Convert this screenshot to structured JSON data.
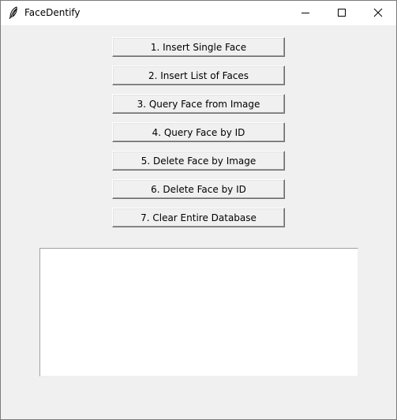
{
  "window": {
    "title": "FaceDentify"
  },
  "buttons": [
    {
      "label": "1. Insert Single Face"
    },
    {
      "label": "2. Insert List of Faces"
    },
    {
      "label": "3. Query Face from Image"
    },
    {
      "label": "4. Query Face by ID"
    },
    {
      "label": "5. Delete Face by Image"
    },
    {
      "label": "6. Delete Face by ID"
    },
    {
      "label": "7. Clear Entire Database"
    }
  ],
  "output": {
    "text": ""
  },
  "icons": {
    "app": "feather-icon",
    "minimize": "minimize-icon",
    "maximize": "maximize-icon",
    "close": "close-icon"
  }
}
